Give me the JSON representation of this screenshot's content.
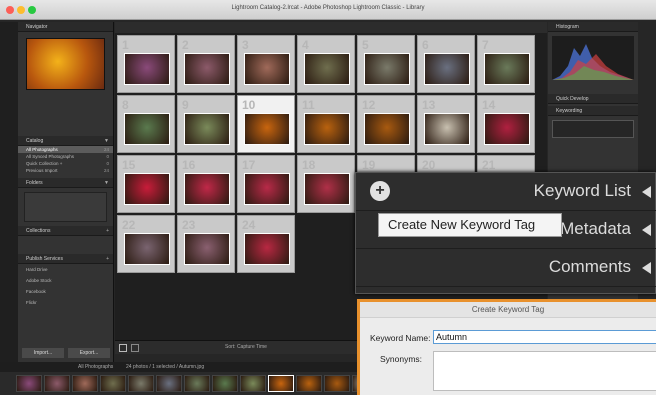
{
  "window": {
    "title": "Lightroom Catalog-2.lrcat - Adobe Photoshop Lightroom Classic - Library",
    "traffic_colors": [
      "#fc5f57",
      "#fdbd2e",
      "#28c941"
    ]
  },
  "left_panel": {
    "navigator_label": "Navigator",
    "catalog": {
      "header": "Catalog",
      "items": [
        {
          "label": "All Photographs",
          "count": "24"
        },
        {
          "label": "All Synced Photographs",
          "count": "0"
        },
        {
          "label": "Quick Collection +",
          "count": "0"
        },
        {
          "label": "Previous Import",
          "count": "24"
        }
      ]
    },
    "folders_header": "Folders",
    "collections_header": "Collections",
    "publish_header": "Publish Services",
    "publish_items": [
      "Hard Drive",
      "Adobe Stock",
      "Facebook",
      "Flickr"
    ],
    "import_button": "Import...",
    "export_button": "Export..."
  },
  "grid": {
    "numbers": [
      "1",
      "2",
      "3",
      "4",
      "5",
      "6",
      "7",
      "8",
      "9",
      "10",
      "11",
      "12",
      "13",
      "14",
      "15",
      "16",
      "17",
      "18",
      "19",
      "20",
      "21",
      "22",
      "23",
      "24"
    ],
    "selected_index": 9,
    "thumb_colors": [
      "#8a4a7a",
      "#8c5a6a",
      "#a06a5a",
      "#6f6e4e",
      "#7a7a6a",
      "#6a7080",
      "#6a7a5a",
      "#5a7a4e",
      "#7a8a5a",
      "#c8650f",
      "#b9620f",
      "#a85a10",
      "#c8c0b0",
      "#b02040",
      "#c81c3a",
      "#c02848",
      "#b82a48",
      "#b03048",
      "#c8202c",
      "#b42438",
      "#6a6a6a",
      "#7a6470",
      "#8a6070",
      "#b82842"
    ],
    "toolbar_sort": "Sort: Capture Time"
  },
  "right_panel": {
    "histogram_label": "Histogram",
    "quick_develop": "Quick Develop",
    "keywording": "Keywording"
  },
  "filmstrip": {
    "source_label": "All Photographs",
    "info": "24 photos / 1 selected / Autumn.jpg"
  },
  "zoom_panel": {
    "rows": [
      "Keyword List",
      "Metadata",
      "Comments"
    ],
    "tooltip": "Create New Keyword Tag"
  },
  "dialog": {
    "title": "Create Keyword Tag",
    "keyword_label": "Keyword Name:",
    "keyword_value": "Autumn",
    "synonyms_label": "Synonyms:"
  }
}
